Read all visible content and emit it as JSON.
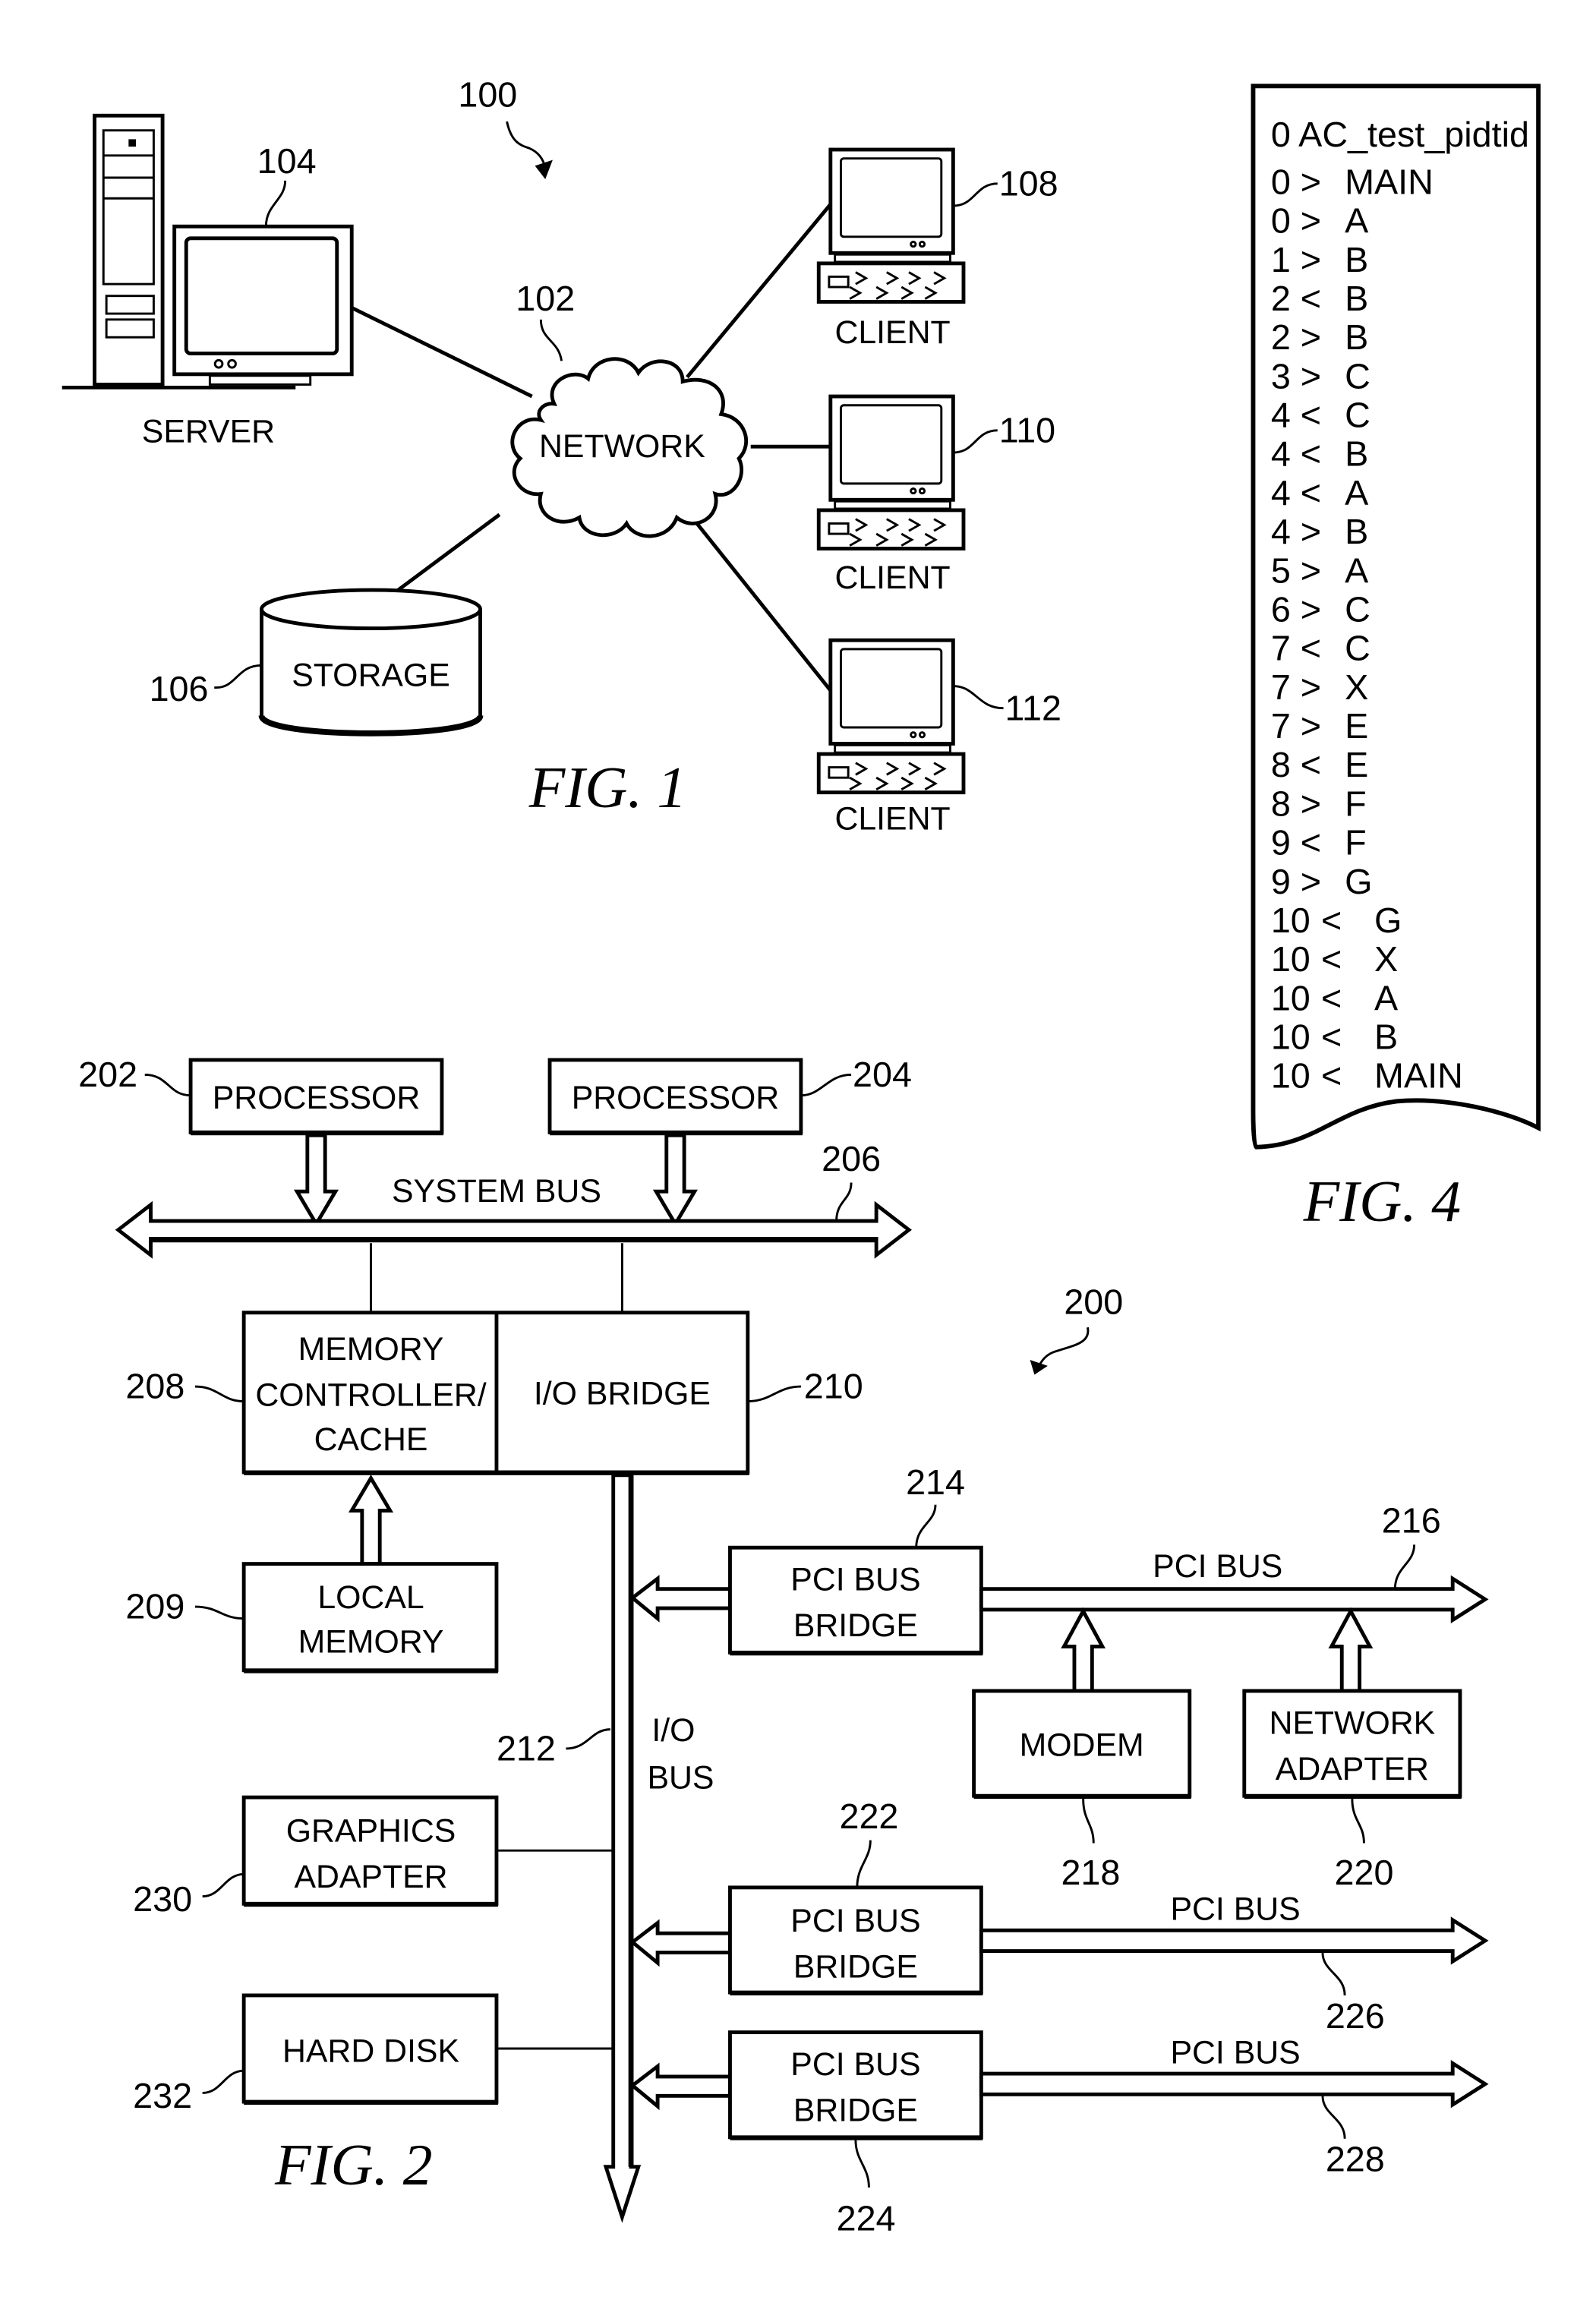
{
  "fig1": {
    "caption": "FIG. 1",
    "system_ref": "100",
    "network": {
      "ref": "102",
      "label": "NETWORK"
    },
    "server": {
      "ref": "104",
      "label": "SERVER"
    },
    "storage": {
      "ref": "106",
      "label": "STORAGE"
    },
    "clients": [
      {
        "ref": "108",
        "label": "CLIENT"
      },
      {
        "ref": "110",
        "label": "CLIENT"
      },
      {
        "ref": "112",
        "label": "CLIENT"
      }
    ]
  },
  "fig2": {
    "caption": "FIG. 2",
    "system_ref": "200",
    "processors": [
      {
        "ref": "202",
        "label": "PROCESSOR"
      },
      {
        "ref": "204",
        "label": "PROCESSOR"
      }
    ],
    "system_bus": {
      "ref": "206",
      "label": "SYSTEM BUS"
    },
    "memory_controller": {
      "ref": "208",
      "lines": [
        "MEMORY",
        "CONTROLLER/",
        "CACHE"
      ]
    },
    "io_bridge": {
      "ref": "210",
      "label": "I/O BRIDGE"
    },
    "local_memory": {
      "ref": "209",
      "lines": [
        "LOCAL",
        "MEMORY"
      ]
    },
    "io_bus": {
      "ref": "212",
      "lines": [
        "I/O",
        "BUS"
      ]
    },
    "pci_bridge_1": {
      "ref": "214",
      "lines": [
        "PCI BUS",
        "BRIDGE"
      ]
    },
    "pci_bus_1": {
      "ref": "216",
      "label": "PCI BUS"
    },
    "modem": {
      "ref": "218",
      "label": "MODEM"
    },
    "network_adapter": {
      "ref": "220",
      "lines": [
        "NETWORK",
        "ADAPTER"
      ]
    },
    "pci_bridge_2": {
      "ref": "222",
      "lines": [
        "PCI BUS",
        "BRIDGE"
      ]
    },
    "pci_bus_2": {
      "ref": "226",
      "label": "PCI BUS"
    },
    "pci_bridge_3": {
      "ref": "224",
      "lines": [
        "PCI BUS",
        "BRIDGE"
      ]
    },
    "pci_bus_3": {
      "ref": "228",
      "label": "PCI BUS"
    },
    "graphics_adapter": {
      "ref": "230",
      "lines": [
        "GRAPHICS",
        "ADAPTER"
      ]
    },
    "hard_disk": {
      "ref": "232",
      "label": "HARD DISK"
    }
  },
  "fig4": {
    "caption": "FIG. 4",
    "header": "0 AC_test_pidtid",
    "trace": [
      {
        "level": "0",
        "dir": ">",
        "name": "MAIN"
      },
      {
        "level": "0",
        "dir": ">",
        "name": "A"
      },
      {
        "level": "1",
        "dir": ">",
        "name": "B"
      },
      {
        "level": "2",
        "dir": "<",
        "name": "B"
      },
      {
        "level": "2",
        "dir": ">",
        "name": "B"
      },
      {
        "level": "3",
        "dir": ">",
        "name": "C"
      },
      {
        "level": "4",
        "dir": "<",
        "name": "C"
      },
      {
        "level": "4",
        "dir": "<",
        "name": "B"
      },
      {
        "level": "4",
        "dir": "<",
        "name": "A"
      },
      {
        "level": "4",
        "dir": ">",
        "name": "B"
      },
      {
        "level": "5",
        "dir": ">",
        "name": "A"
      },
      {
        "level": "6",
        "dir": ">",
        "name": "C"
      },
      {
        "level": "7",
        "dir": "<",
        "name": "C"
      },
      {
        "level": "7",
        "dir": ">",
        "name": "X"
      },
      {
        "level": "7",
        "dir": ">",
        "name": "E"
      },
      {
        "level": "8",
        "dir": "<",
        "name": "E"
      },
      {
        "level": "8",
        "dir": ">",
        "name": "F"
      },
      {
        "level": "9",
        "dir": "<",
        "name": "F"
      },
      {
        "level": "9",
        "dir": ">",
        "name": "G"
      },
      {
        "level": "10",
        "dir": "<",
        "name": "G"
      },
      {
        "level": "10",
        "dir": "<",
        "name": "X"
      },
      {
        "level": "10",
        "dir": "<",
        "name": "A"
      },
      {
        "level": "10",
        "dir": "<",
        "name": "B"
      },
      {
        "level": "10",
        "dir": "<",
        "name": "MAIN"
      }
    ]
  }
}
